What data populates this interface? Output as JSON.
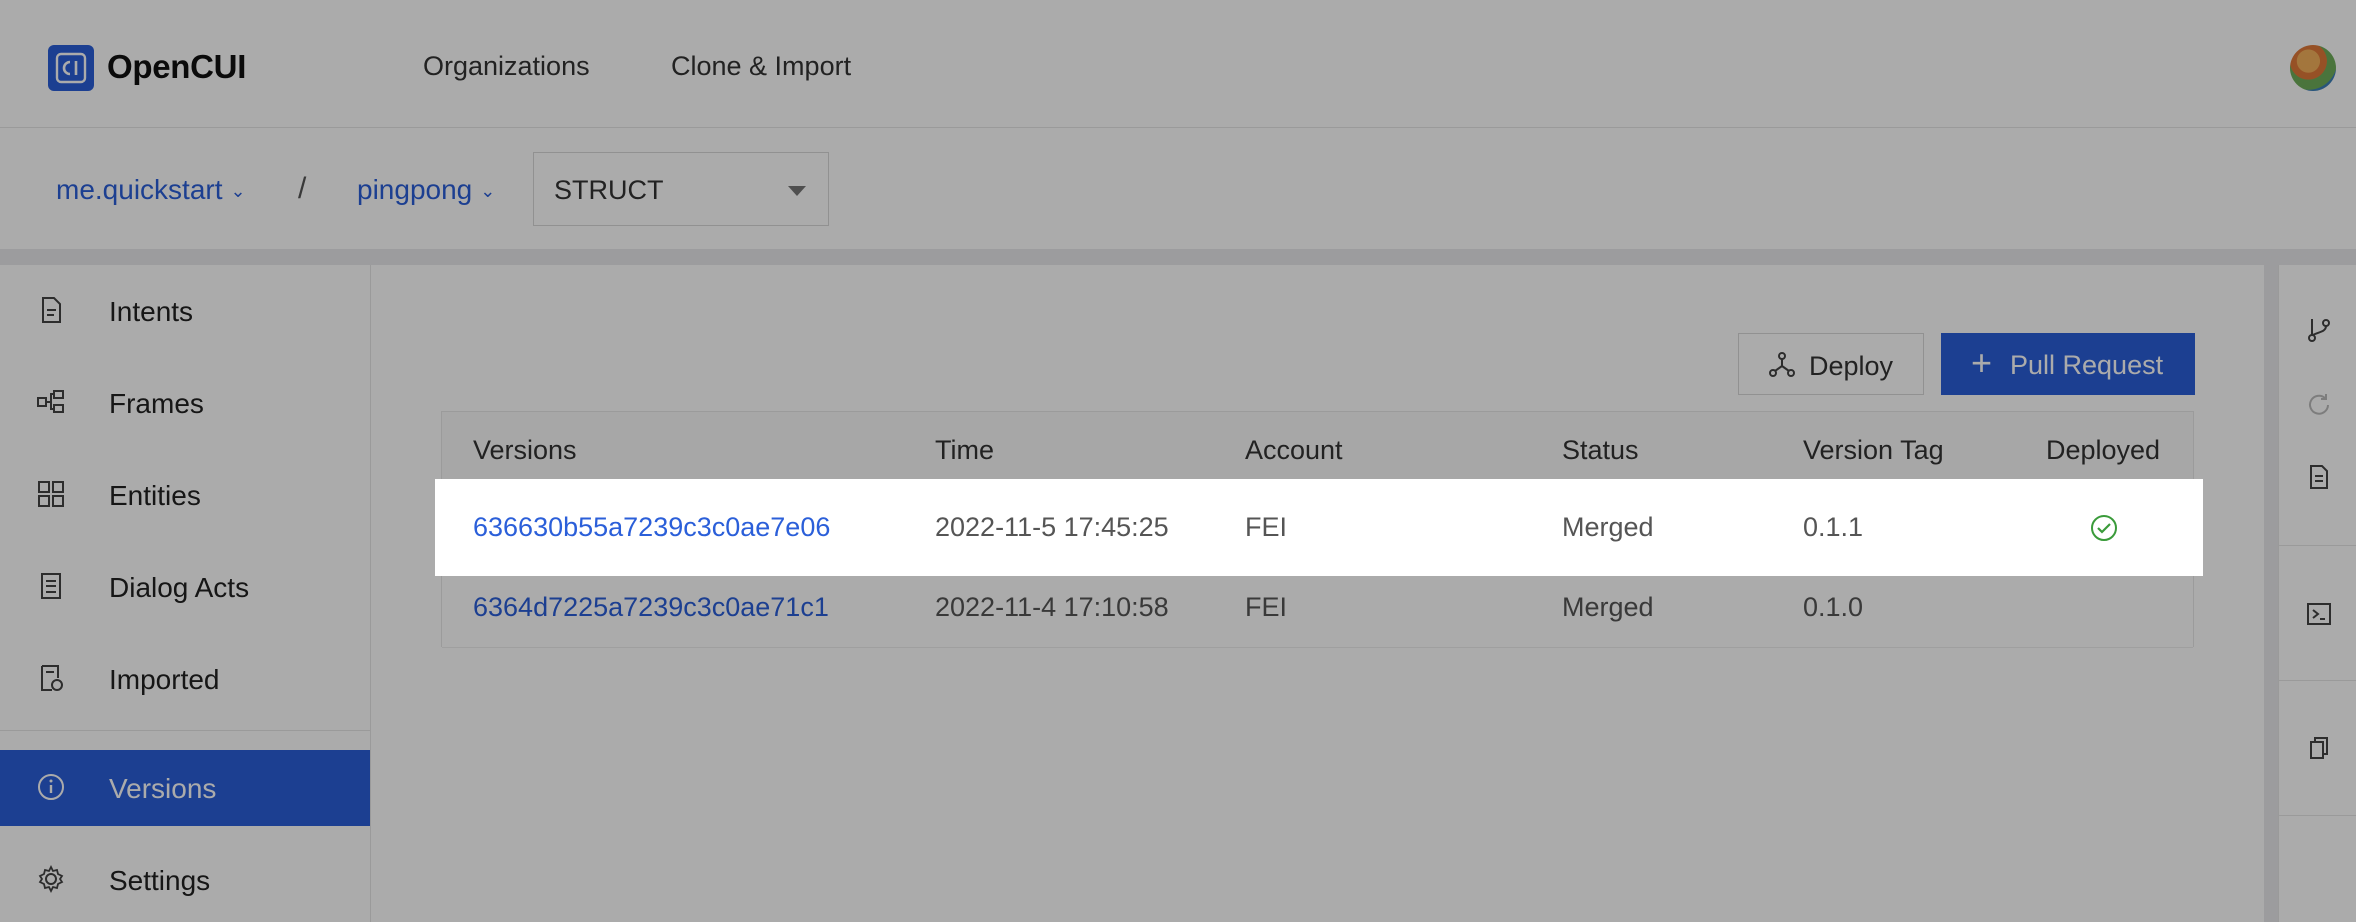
{
  "app": {
    "brand": "OpenCUI",
    "logo_text": "CI"
  },
  "topnav": {
    "organizations": "Organizations",
    "clone_import": "Clone & Import"
  },
  "breadcrumb": {
    "org": "me.quickstart",
    "separator": "/",
    "project": "pingpong"
  },
  "struct_select": {
    "value": "STRUCT"
  },
  "sidebar": {
    "items": [
      {
        "label": "Intents",
        "icon": "document-icon"
      },
      {
        "label": "Frames",
        "icon": "frames-icon"
      },
      {
        "label": "Entities",
        "icon": "entities-icon"
      },
      {
        "label": "Dialog Acts",
        "icon": "dialog-acts-icon"
      },
      {
        "label": "Imported",
        "icon": "imported-icon"
      },
      {
        "label": "Versions",
        "icon": "info-icon",
        "active": true
      },
      {
        "label": "Settings",
        "icon": "gear-icon"
      }
    ]
  },
  "toolbar": {
    "deploy_label": "Deploy",
    "pull_request_label": "Pull Request"
  },
  "table": {
    "headers": [
      "Versions",
      "Time",
      "Account",
      "Status",
      "Version Tag",
      "Deployed"
    ],
    "rows": [
      {
        "version": "636630b55a7239c3c0ae7e06",
        "time": "2022-11-5 17:45:25",
        "account": "FEI",
        "status": "Merged",
        "tag": "0.1.1",
        "deployed": true
      },
      {
        "version": "6364d7225a7239c3c0ae71c1",
        "time": "2022-11-4 17:10:58",
        "account": "FEI",
        "status": "Merged",
        "tag": "0.1.0",
        "deployed": false
      }
    ]
  },
  "colors": {
    "accent": "#2b5fd9",
    "deployed_check": "#3a9b3a"
  },
  "right_rail": {
    "icons": [
      "branch-icon",
      "refresh-icon",
      "report-icon",
      "terminal-icon",
      "copy-icon"
    ]
  }
}
